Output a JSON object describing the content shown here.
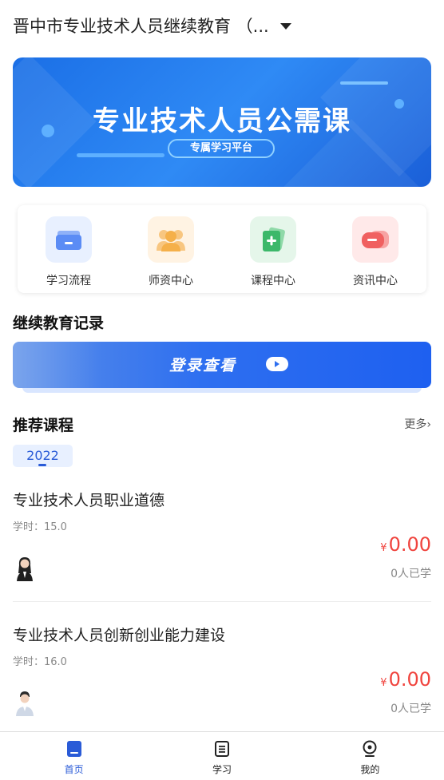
{
  "header": {
    "title": "晋中市专业技术人员继续教育 （...",
    "dropdown_icon": "caret-down-icon"
  },
  "banner": {
    "title": "专业技术人员公需课",
    "subtitle": "专属学习平台"
  },
  "quick_entries": [
    {
      "label": "学习流程",
      "icon": "folder-icon",
      "color": "#5b8cf5"
    },
    {
      "label": "师资中心",
      "icon": "group-icon",
      "color": "#f5b04a"
    },
    {
      "label": "课程中心",
      "icon": "add-card-icon",
      "color": "#3cb86a"
    },
    {
      "label": "资讯中心",
      "icon": "message-icon",
      "color": "#f06060"
    }
  ],
  "records": {
    "title": "继续教育记录",
    "login_label": "登录查看"
  },
  "recommended": {
    "title": "推荐课程",
    "more_label": "更多›",
    "year_tab": "2022"
  },
  "courses": [
    {
      "title": "专业技术人员职业道德",
      "hours": "学时：15.0",
      "currency": "¥",
      "price": "0.00",
      "learners": "0人已学",
      "avatar": "female-teacher-avatar"
    },
    {
      "title": "专业技术人员创新创业能力建设",
      "hours": "学时：16.0",
      "currency": "¥",
      "price": "0.00",
      "learners": "0人已学",
      "avatar": "male-teacher-avatar"
    }
  ],
  "tabbar": [
    {
      "label": "首页",
      "icon": "home-icon",
      "active": true
    },
    {
      "label": "学习",
      "icon": "document-icon",
      "active": false
    },
    {
      "label": "我的",
      "icon": "profile-icon",
      "active": false
    }
  ],
  "colors": {
    "accent": "#2a5bd7",
    "price": "#f0443e",
    "banner": "#1b6fe6"
  }
}
